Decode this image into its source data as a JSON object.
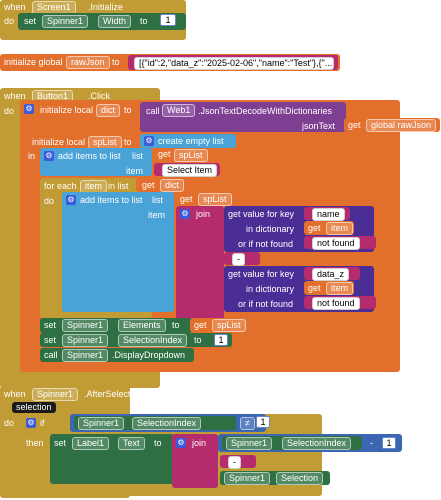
{
  "blocks": {
    "b1": {
      "when": "when",
      "component": "Screen1",
      "event": ".Initialize",
      "do": "do",
      "set": "set",
      "target": "Spinner1",
      "prop": "Width",
      "to": "to",
      "value": "1"
    },
    "b2": {
      "init": "initialize global",
      "var": "rawJson",
      "to": "to",
      "value": "[{\"id\":2,\"data_z\":\"2025-02-06\",\"name\":\"Test\"},{\"..."
    },
    "b3": {
      "when": "when",
      "component": "Button1",
      "event": ".Click",
      "do": "do",
      "init_local": "initialize local",
      "dict_var": "dict",
      "to": "to",
      "call": "call",
      "web": "Web1",
      "method": ".JsonTextDecodeWithDictionaries",
      "json_text": "jsonText",
      "get": "get",
      "global_raw": "global rawJson",
      "init_local2": "initialize local",
      "splist": "spList",
      "create_list": "create empty list",
      "in": "in",
      "add_items": "add items to list",
      "list": "list",
      "item": "item",
      "select_item": "Select Item",
      "for_each": "for each",
      "item_var": "item",
      "in_list": "in list",
      "join": "join",
      "get_value": "get value for key",
      "in_dictionary": "in dictionary",
      "or_if_not_found": "or if not found",
      "key_name": "name",
      "key_dataz": "data_z",
      "not_found": "not found",
      "sep": " - ",
      "elements": "Elements",
      "selection_index": "SelectionIndex",
      "sel_value": "1",
      "display_dropdown": ".DisplayDropdown"
    },
    "b4": {
      "when": "when",
      "component": "Spinner1",
      "event": ".AfterSelecting",
      "param": "selection",
      "do": "do",
      "if": "if",
      "then": "then",
      "neq": "≠",
      "one": "1",
      "set": "set",
      "label": "Label1",
      "text_prop": "Text",
      "to": "to",
      "join": "join",
      "spinner": "Spinner1",
      "sel_index": "SelectionIndex",
      "minus": "-",
      "minus_one": "1",
      "sep": " - ",
      "selection_prop": "Selection"
    }
  },
  "colors": {
    "event": "#c19b33",
    "global": "#e36f2c",
    "text": "#b42c6d",
    "component": "#2e6f43",
    "list": "#4aa3d6",
    "dictionary": "#4a2e96",
    "math": "#3a66b2",
    "web": "#7e3f93"
  }
}
